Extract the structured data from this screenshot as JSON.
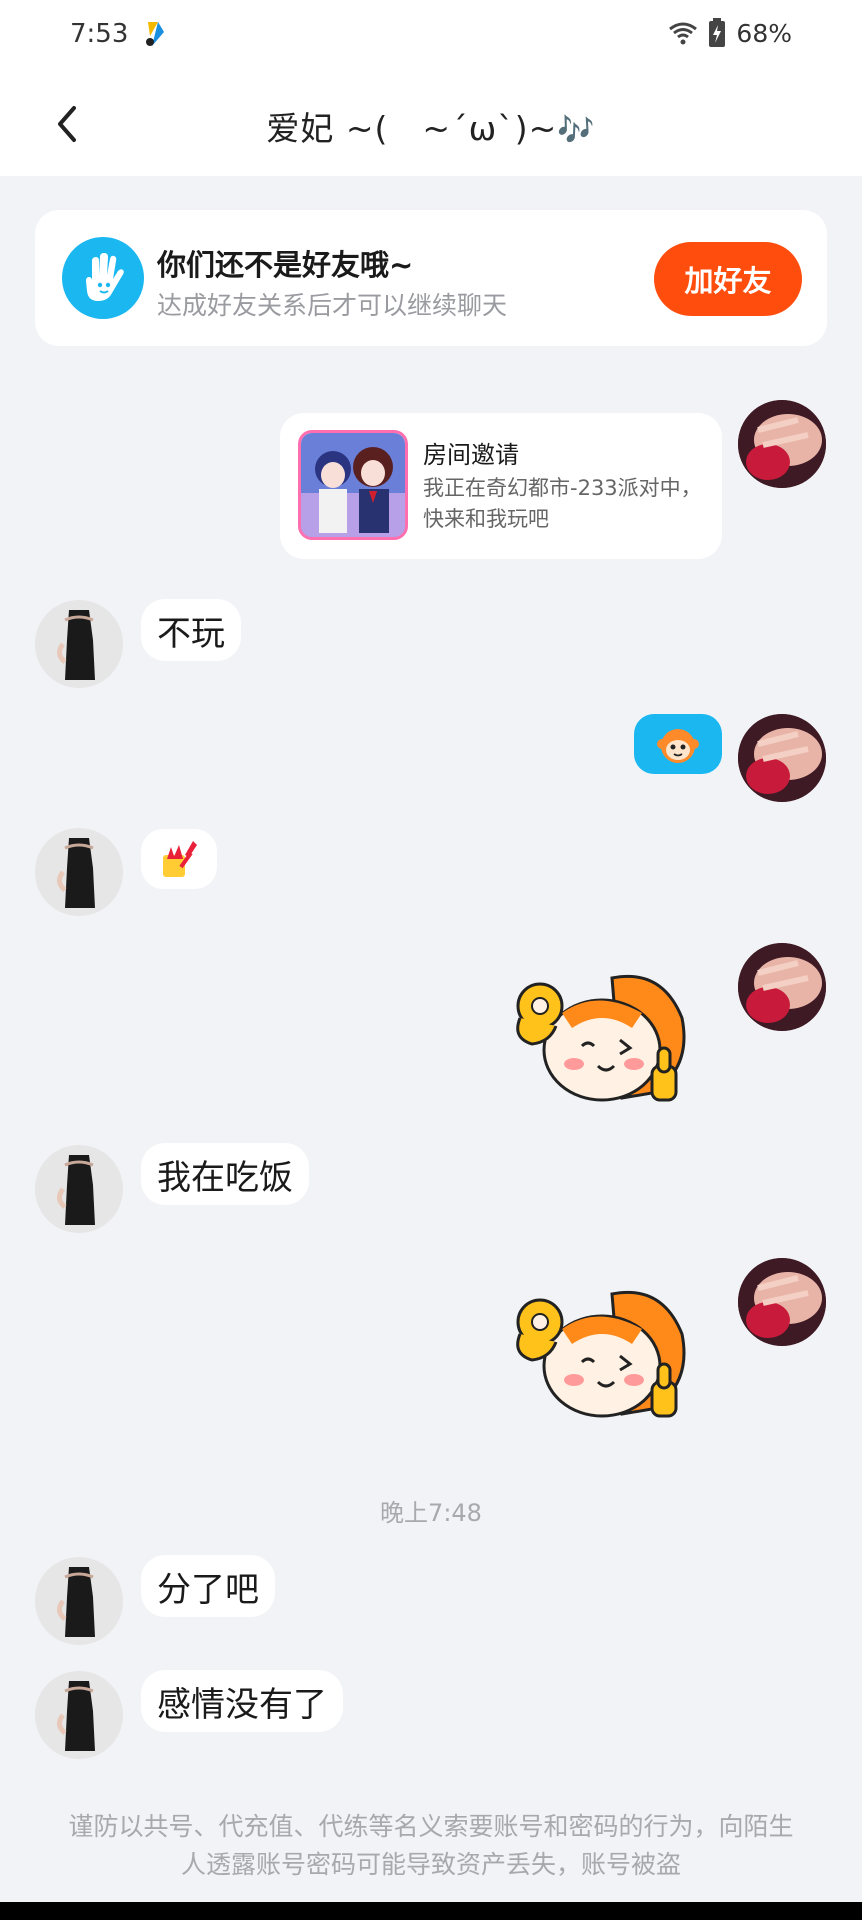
{
  "status_bar": {
    "time": "7:53",
    "battery_percent": "68%",
    "icons": [
      "app-notification-icon",
      "wifi-icon",
      "battery-charging-icon"
    ]
  },
  "header": {
    "title": "爱妃 ~(　~´ω`)~",
    "title_note": "🎶"
  },
  "friend_banner": {
    "title": "你们还不是好友哦~",
    "subtitle": "达成好友关系后才可以继续聊天",
    "button_label": "加好友",
    "button_color": "#ff4d0d",
    "badge_color": "#1ab7f0"
  },
  "messages": [
    {
      "side": "self",
      "type": "room_invite",
      "title": "房间邀请",
      "text": "我正在奇幻都市-233派对中，快来和我玩吧"
    },
    {
      "side": "other",
      "type": "text",
      "text": "不玩"
    },
    {
      "side": "self",
      "type": "emoji",
      "emoji": "monkey-face"
    },
    {
      "side": "other",
      "type": "emoji",
      "emoji": "nail-polish"
    },
    {
      "side": "self",
      "type": "sticker",
      "sticker": "monkey-ok-thumbs-up"
    },
    {
      "side": "other",
      "type": "text",
      "text": "我在吃饭"
    },
    {
      "side": "self",
      "type": "sticker",
      "sticker": "monkey-ok-thumbs-up"
    },
    {
      "side": "other",
      "type": "text",
      "text": "分了吧"
    },
    {
      "side": "other",
      "type": "text",
      "text": "感情没有了"
    }
  ],
  "time_divider": "晚上7:48",
  "safety_notice": "谨防以共号、代充值、代练等名义索要账号和密码的行为，向陌生人透露账号密码可能导致资产丢失，账号被盗"
}
